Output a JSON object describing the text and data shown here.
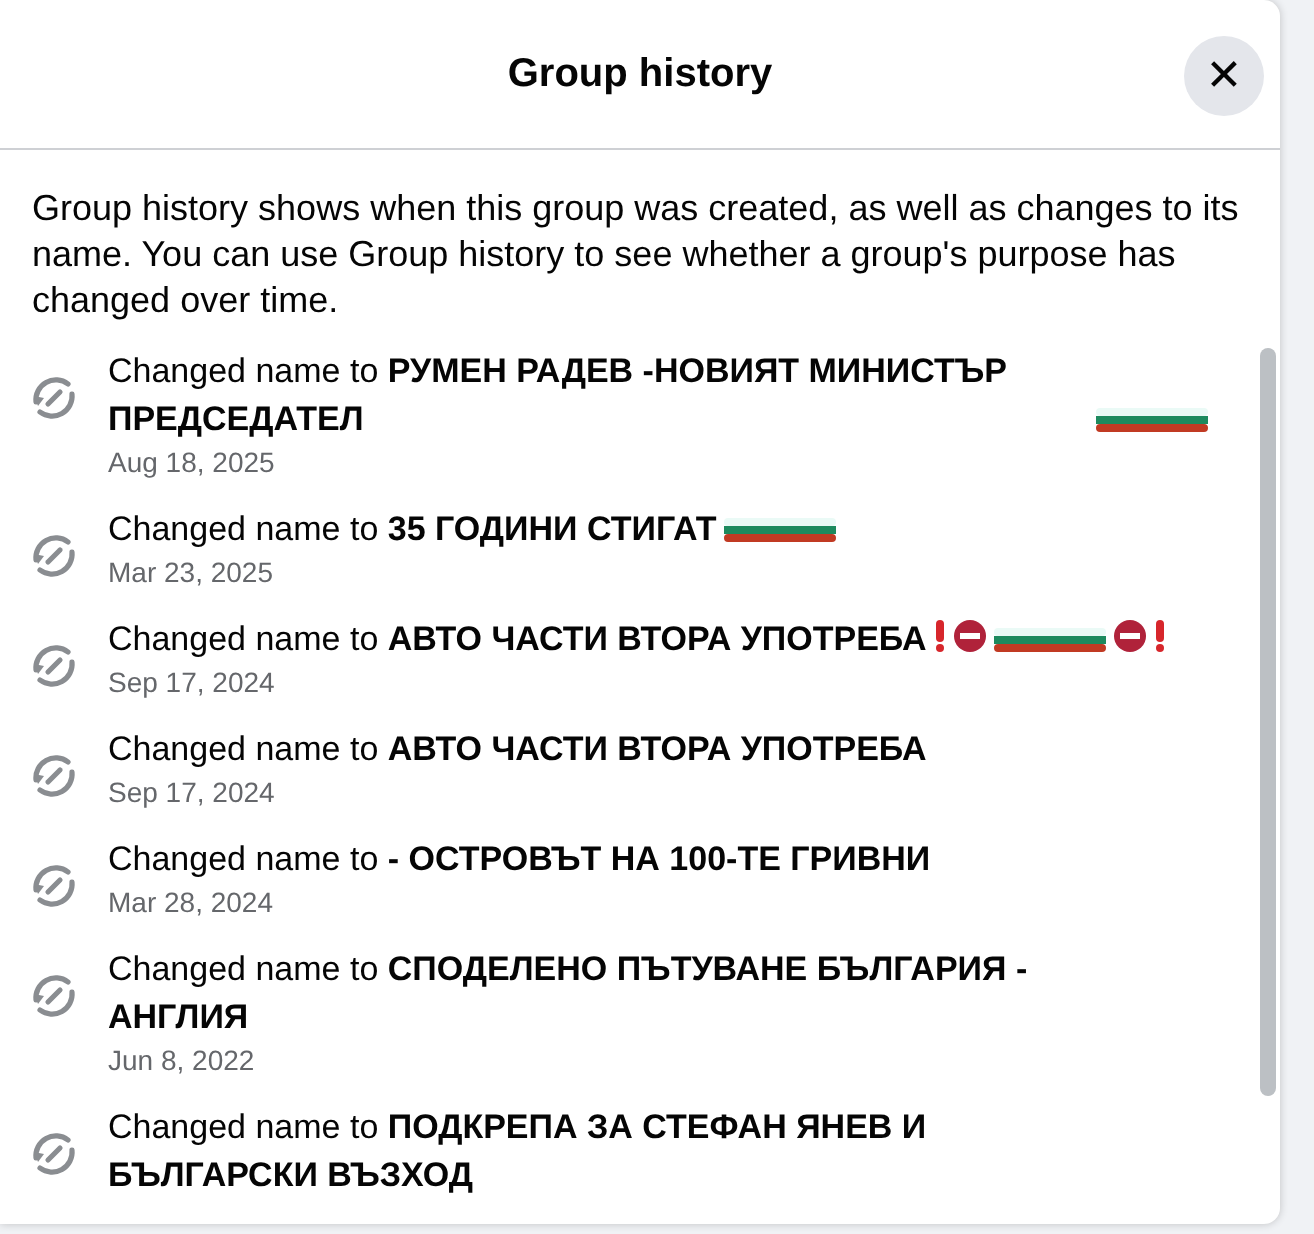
{
  "dialog": {
    "title": "Group history",
    "close_label": "✕"
  },
  "intro": "Group history shows when this group was created, as well as changes to its name. You can use Group history to see whether a group's purpose has changed over time.",
  "entries": [
    {
      "text": "Changed name to **РУМЕН РАДЕВ -НОВИЯТ МИНИСТЪР ПРЕДСЕДАТЕЛ**",
      "emblems": [
        {
          "kind": "flag"
        }
      ],
      "date": "Aug 18, 2025"
    },
    {
      "text": "Changed name to **35 ГОДИНИ СТИГАТ**",
      "emblems": [
        {
          "kind": "flag"
        }
      ],
      "date": "Mar 23, 2025"
    },
    {
      "text": "Changed name to **АВТО ЧАСТИ ВТОРА УПОТРЕБА**",
      "emblems": [
        {
          "kind": "exclamation"
        },
        {
          "kind": "no-entry"
        },
        {
          "kind": "flag"
        },
        {
          "kind": "no-entry"
        },
        {
          "kind": "exclamation"
        }
      ],
      "date": "Sep 17, 2024"
    },
    {
      "text": "Changed name to **АВТО ЧАСТИ ВТОРА УПОТРЕБА**",
      "date": "Sep 17, 2024"
    },
    {
      "text": "Changed name to **- ОСТРОВЪТ НА 100-ТЕ ГРИВНИ**",
      "date": "Mar 28, 2024"
    },
    {
      "text": "Changed name to **СПОДЕЛЕНО ПЪТУВАНЕ БЪЛГАРИЯ - АНГЛИЯ**",
      "date": "Jun 8, 2022"
    },
    {
      "text": "Changed name to **ПОДКРЕПА ЗА СТЕФАН ЯНЕВ И БЪЛГАРСКИ ВЪЗХОД**"
    }
  ]
}
